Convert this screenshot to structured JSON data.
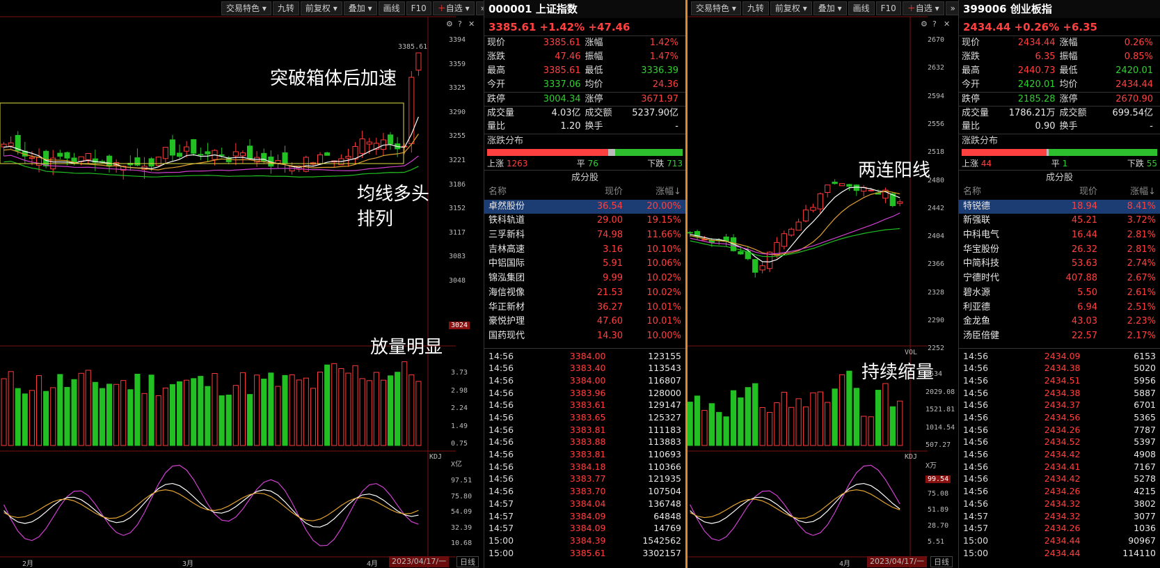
{
  "toolbar": {
    "items": [
      "交易特色",
      "九转",
      "前复权",
      "叠加",
      "画线",
      "F10",
      "自选"
    ],
    "collapse": "»"
  },
  "left_chart": {
    "price_axis": [
      "3394",
      "3359",
      "3325",
      "3290",
      "3255",
      "3221",
      "3186",
      "3152",
      "3117",
      "3083",
      "3048",
      "3024"
    ],
    "high_label": "3385.61",
    "vol_axis": [
      "3.73",
      "2.98",
      "2.24",
      "1.49",
      "0.75",
      "X亿"
    ],
    "kdj_label": "KDJ",
    "kdj_axis": [
      "97.51",
      "75.80",
      "54.09",
      "32.39",
      "10.68"
    ],
    "months": [
      "2月",
      "3月",
      "4月"
    ],
    "date": "2023/04/17/一",
    "period": "日线",
    "annotations": {
      "a1": "突破箱体后加速",
      "a2": "均线多头",
      "a3": "排列",
      "a4": "放量明显"
    }
  },
  "right_chart": {
    "price_axis": [
      "2670",
      "2632",
      "2594",
      "2556",
      "2518",
      "2480",
      "2442",
      "2404",
      "2366",
      "2328",
      "2290",
      "2252"
    ],
    "vol_label": "VOL",
    "vol_axis": [
      "2534",
      "2029.08",
      "1521.81",
      "1014.54",
      "507.27",
      "X万"
    ],
    "kdj_label": "KDJ",
    "kdj_current": "99.54",
    "kdj_axis": [
      "75.08",
      "51.89",
      "28.70",
      "5.51"
    ],
    "months": [
      "4月"
    ],
    "date": "2023/04/17/一",
    "period": "日线",
    "annotations": {
      "a1": "两连阳线",
      "a2": "持续缩量"
    }
  },
  "sh": {
    "title": "000001 上证指数",
    "price_line": "3385.61  +1.42%  +47.46",
    "stats": [
      [
        "现价",
        "3385.61",
        "涨幅",
        "1.42%"
      ],
      [
        "涨跌",
        "47.46",
        "振幅",
        "1.47%"
      ],
      [
        "最高",
        "3385.61",
        "最低",
        "3336.39"
      ],
      [
        "今开",
        "3337.06",
        "均价",
        "24.36"
      ],
      [
        "跌停",
        "3004.34",
        "涨停",
        "3671.97"
      ],
      [
        "成交量",
        "4.03亿",
        "成交额",
        "5237.90亿"
      ],
      [
        "量比",
        "1.20",
        "换手",
        "-"
      ]
    ],
    "dist_title": "涨跌分布",
    "up_label": "上涨",
    "up": "1263",
    "flat_label": "平",
    "flat": "76",
    "down_label": "下跌",
    "down": "713",
    "cf_title": "成分股",
    "cf_cols": [
      "名称",
      "现价",
      "涨幅↓"
    ],
    "cf_rows": [
      [
        "卓然股份",
        "36.54",
        "20.00%"
      ],
      [
        "铁科轨道",
        "29.00",
        "19.15%"
      ],
      [
        "三孚新科",
        "74.98",
        "11.66%"
      ],
      [
        "吉林高速",
        "3.16",
        "10.10%"
      ],
      [
        "中铝国际",
        "5.91",
        "10.06%"
      ],
      [
        "锦泓集团",
        "9.99",
        "10.02%"
      ],
      [
        "海信视像",
        "21.53",
        "10.02%"
      ],
      [
        "华正新材",
        "36.27",
        "10.01%"
      ],
      [
        "豪悦护理",
        "47.60",
        "10.01%"
      ],
      [
        "国药现代",
        "14.30",
        "10.00%"
      ]
    ],
    "ticks": [
      [
        "14:56",
        "3384.00",
        "123155"
      ],
      [
        "14:56",
        "3383.40",
        "113543"
      ],
      [
        "14:56",
        "3384.00",
        "116807"
      ],
      [
        "14:56",
        "3383.96",
        "128000"
      ],
      [
        "14:56",
        "3383.61",
        "129147"
      ],
      [
        "14:56",
        "3383.65",
        "125327"
      ],
      [
        "14:56",
        "3383.81",
        "111183"
      ],
      [
        "14:56",
        "3383.88",
        "113883"
      ],
      [
        "14:56",
        "3383.81",
        "110693"
      ],
      [
        "14:56",
        "3384.18",
        "110366"
      ],
      [
        "14:56",
        "3383.77",
        "121935"
      ],
      [
        "14:56",
        "3383.70",
        "107504"
      ],
      [
        "14:57",
        "3384.04",
        "136748"
      ],
      [
        "14:57",
        "3384.09",
        "64848"
      ],
      [
        "14:57",
        "3384.09",
        "14769"
      ],
      [
        "15:00",
        "3384.39",
        "1542562"
      ],
      [
        "15:00",
        "3385.61",
        "3302157"
      ]
    ]
  },
  "cy": {
    "title": "399006 创业板指",
    "price_line": "2434.44  +0.26%  +6.35",
    "stats": [
      [
        "现价",
        "2434.44",
        "涨幅",
        "0.26%"
      ],
      [
        "涨跌",
        "6.35",
        "振幅",
        "0.85%"
      ],
      [
        "最高",
        "2440.73",
        "最低",
        "2420.01"
      ],
      [
        "今开",
        "2420.01",
        "均价",
        "2434.44"
      ],
      [
        "跌停",
        "2185.28",
        "涨停",
        "2670.90"
      ],
      [
        "成交量",
        "1786.21万",
        "成交额",
        "699.54亿"
      ],
      [
        "量比",
        "0.90",
        "换手",
        "-"
      ]
    ],
    "dist_title": "涨跌分布",
    "up_label": "上涨",
    "up": "44",
    "flat_label": "平",
    "flat": "1",
    "down_label": "下跌",
    "down": "55",
    "cf_title": "成分股",
    "cf_cols": [
      "名称",
      "现价",
      "涨幅↓"
    ],
    "cf_rows": [
      [
        "特锐德",
        "18.94",
        "8.41%"
      ],
      [
        "新强联",
        "45.21",
        "3.72%"
      ],
      [
        "中科电气",
        "16.44",
        "2.81%"
      ],
      [
        "华宝股份",
        "26.32",
        "2.81%"
      ],
      [
        "中简科技",
        "53.63",
        "2.74%"
      ],
      [
        "宁德时代",
        "407.88",
        "2.67%"
      ],
      [
        "碧水源",
        "5.50",
        "2.61%"
      ],
      [
        "利亚德",
        "6.94",
        "2.51%"
      ],
      [
        "金龙鱼",
        "43.03",
        "2.23%"
      ],
      [
        "汤臣倍健",
        "22.57",
        "2.17%"
      ]
    ],
    "ticks": [
      [
        "14:56",
        "2434.09",
        "6153"
      ],
      [
        "14:56",
        "2434.38",
        "5020"
      ],
      [
        "14:56",
        "2434.51",
        "5956"
      ],
      [
        "14:56",
        "2434.38",
        "5887"
      ],
      [
        "14:56",
        "2434.37",
        "6701"
      ],
      [
        "14:56",
        "2434.56",
        "5365"
      ],
      [
        "14:56",
        "2434.26",
        "7787"
      ],
      [
        "14:56",
        "2434.52",
        "5397"
      ],
      [
        "14:56",
        "2434.42",
        "4908"
      ],
      [
        "14:56",
        "2434.41",
        "7167"
      ],
      [
        "14:56",
        "2434.42",
        "5278"
      ],
      [
        "14:56",
        "2434.26",
        "4215"
      ],
      [
        "14:56",
        "2434.32",
        "3802"
      ],
      [
        "14:57",
        "2434.32",
        "3077"
      ],
      [
        "14:57",
        "2434.26",
        "1036"
      ],
      [
        "15:00",
        "2434.44",
        "90967"
      ],
      [
        "15:00",
        "2434.44",
        "114110"
      ]
    ]
  },
  "colors": {
    "up": "#ff4040",
    "down": "#2ebf2e",
    "accent": "#e08a2a",
    "selected": "#1c3c74"
  }
}
